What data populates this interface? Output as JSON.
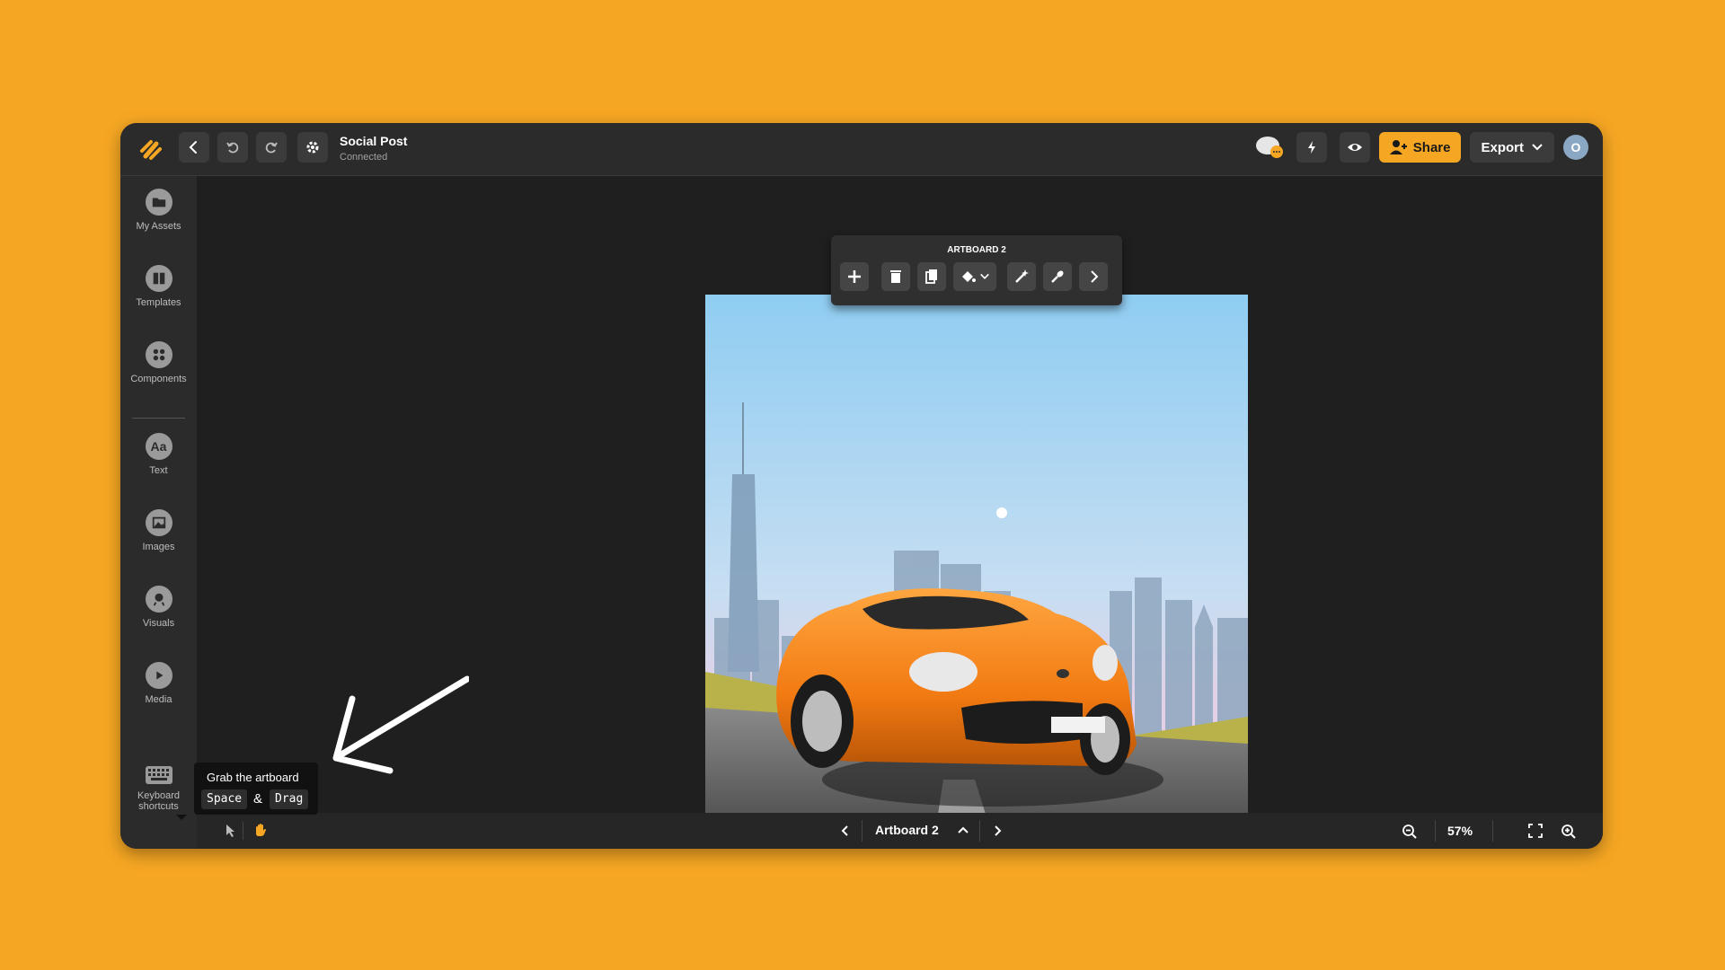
{
  "app": {
    "document_title": "Social Post",
    "status": "Connected"
  },
  "topbar": {
    "share_label": "Share",
    "export_label": "Export",
    "avatar_initial": "O"
  },
  "sidebar": {
    "items": [
      {
        "label": "My Assets",
        "icon": "folder-icon"
      },
      {
        "label": "Templates",
        "icon": "templates-icon"
      },
      {
        "label": "Components",
        "icon": "components-icon"
      },
      {
        "label": "Text",
        "icon": "text-icon"
      },
      {
        "label": "Images",
        "icon": "images-icon"
      },
      {
        "label": "Visuals",
        "icon": "visuals-icon"
      },
      {
        "label": "Media",
        "icon": "media-icon"
      },
      {
        "label": "Keyboard shortcuts",
        "icon": "keyboard-icon"
      }
    ]
  },
  "artboard_toolbar": {
    "label": "ARTBOARD 2"
  },
  "tooltip": {
    "title": "Grab the artboard",
    "key1": "Space",
    "joiner": "&",
    "key2": "Drag"
  },
  "bottombar": {
    "artboard_name": "Artboard 2",
    "zoom": "57%"
  },
  "colors": {
    "background": "#F5A623",
    "accent": "#F5A623",
    "app_bg": "#1f1f1f",
    "panel_bg": "#2b2b2b"
  }
}
